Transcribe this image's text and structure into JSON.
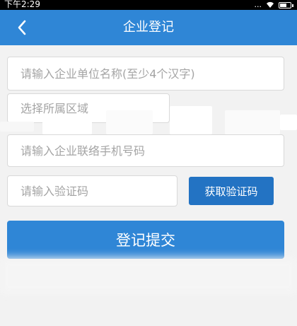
{
  "status_bar": {
    "time": "下午2:29",
    "signal_text": "...",
    "battery_level": 0.7
  },
  "nav": {
    "title": "企业登记"
  },
  "form": {
    "company_name_placeholder": "请输入企业单位名称(至少4个汉字)",
    "region_placeholder": "选择所属区域",
    "phone_placeholder": "请输入企业联络手机号码",
    "code_placeholder": "请输入验证码",
    "get_code_label": "获取验证码",
    "submit_label": "登记提交"
  },
  "colors": {
    "nav_bg": "#2f86d6",
    "button_bg": "#2373c3",
    "page_bg": "#f2f2f2"
  },
  "icons": {
    "back": "chevron-left-icon",
    "wifi": "wifi-icon",
    "battery": "battery-icon"
  }
}
